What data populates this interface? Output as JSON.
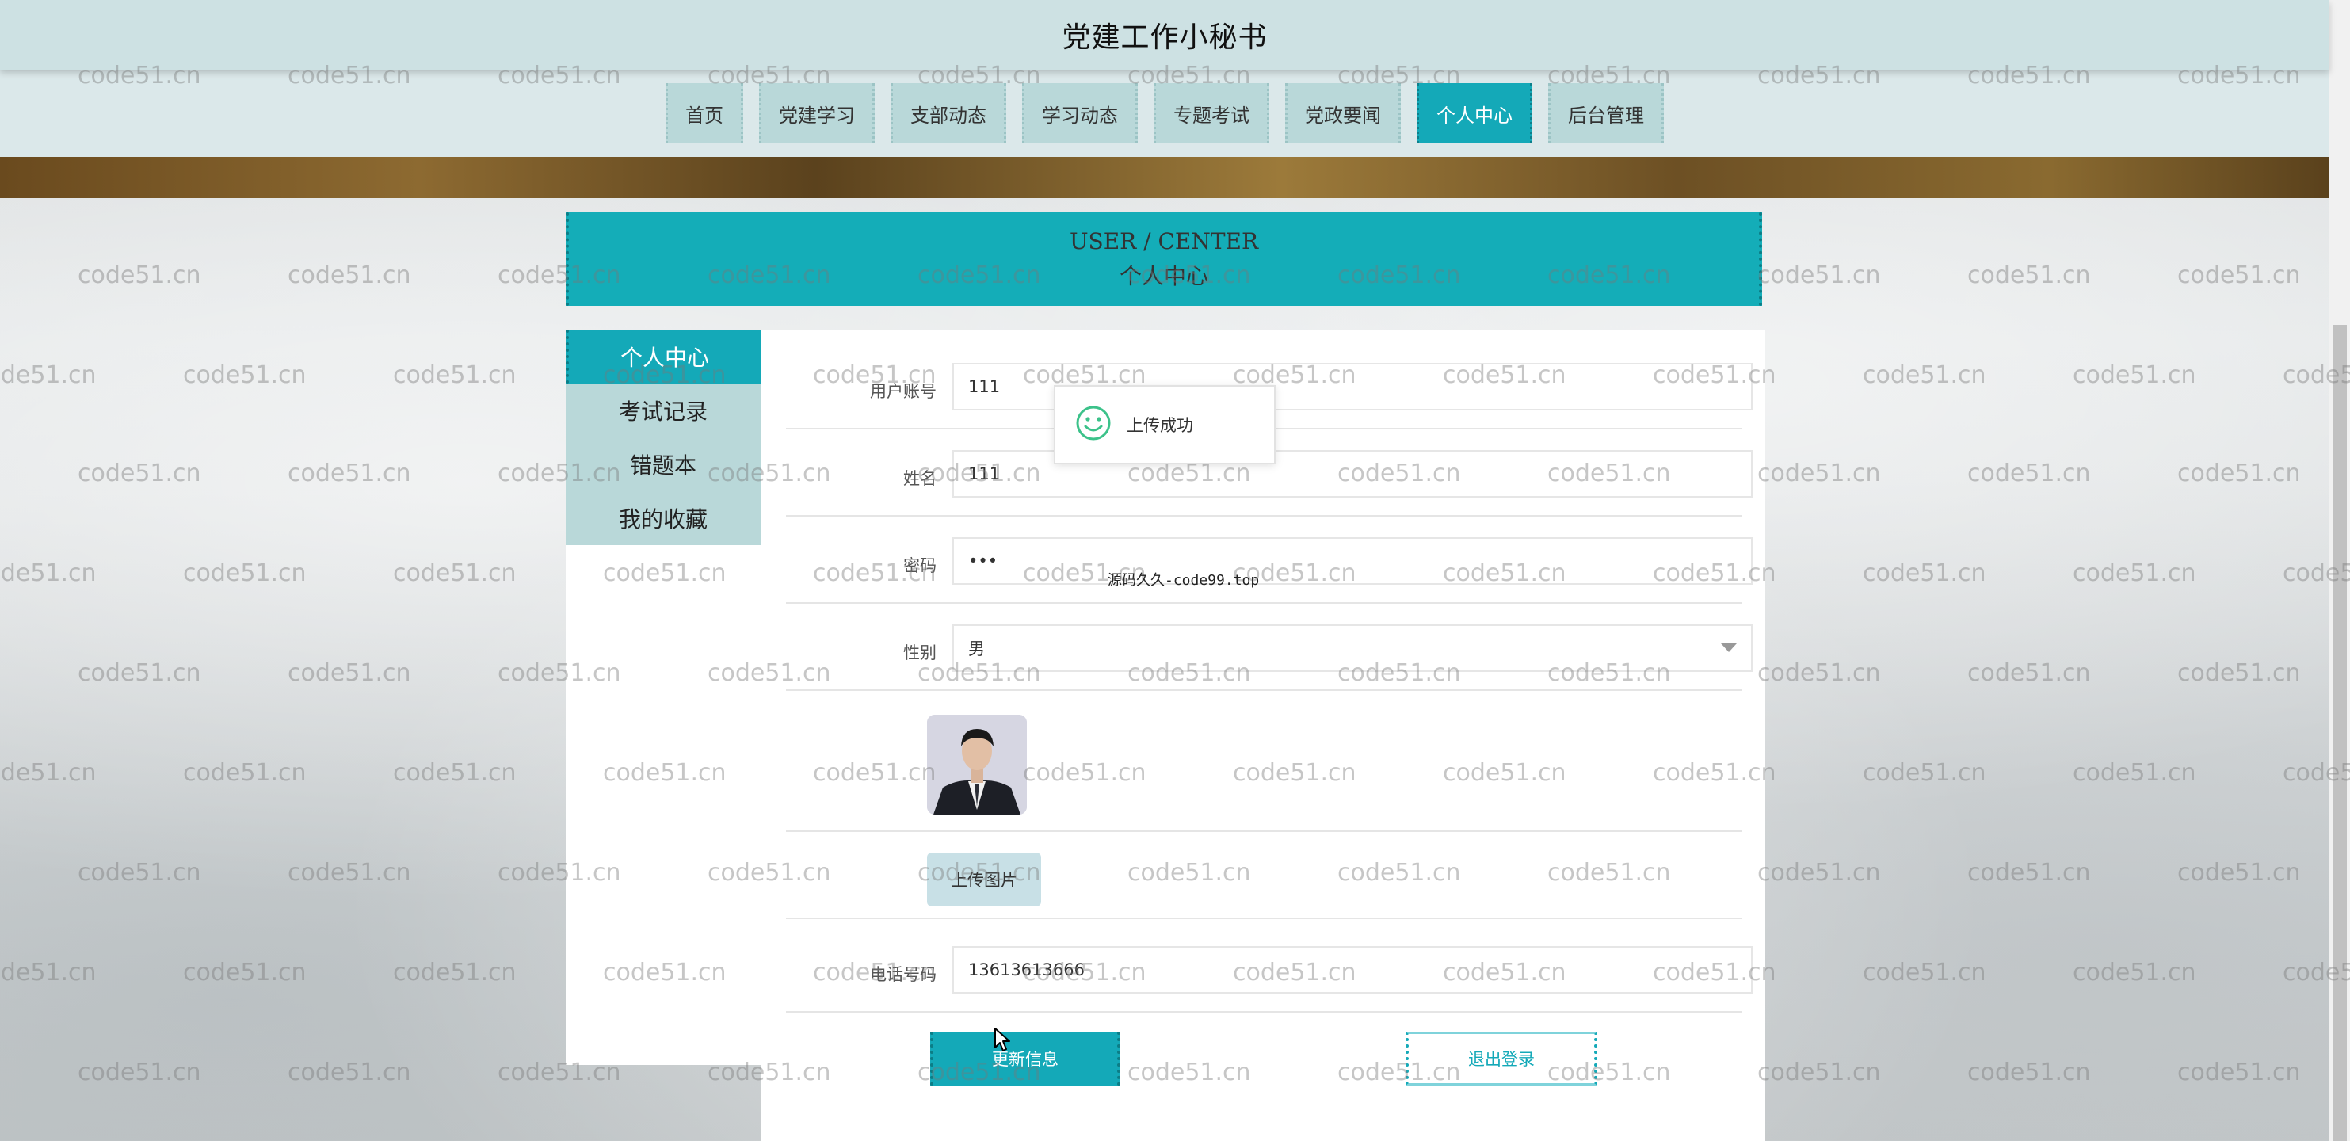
{
  "site": {
    "title": "党建工作小秘书"
  },
  "nav": {
    "items": [
      {
        "label": "首页"
      },
      {
        "label": "党建学习"
      },
      {
        "label": "支部动态"
      },
      {
        "label": "学习动态"
      },
      {
        "label": "专题考试"
      },
      {
        "label": "党政要闻"
      },
      {
        "label": "个人中心",
        "active": true
      },
      {
        "label": "后台管理"
      }
    ]
  },
  "header": {
    "title_en": "USER / CENTER",
    "title_zh": "个人中心"
  },
  "sidebar": {
    "items": [
      {
        "label": "个人中心",
        "active": true
      },
      {
        "label": "考试记录"
      },
      {
        "label": "错题本"
      },
      {
        "label": "我的收藏"
      }
    ]
  },
  "form": {
    "account": {
      "label": "用户账号",
      "value": "111"
    },
    "name": {
      "label": "姓名",
      "value": "111"
    },
    "password": {
      "label": "密码",
      "value": "•••"
    },
    "gender": {
      "label": "性别",
      "value": "男"
    },
    "upload_label": "上传图片",
    "phone": {
      "label": "电话号码",
      "value": "13613613666"
    }
  },
  "actions": {
    "update_label": "更新信息",
    "logout_label": "退出登录"
  },
  "toast": {
    "message": "上传成功",
    "icon": "smile-icon"
  },
  "source_mark": "源码久久-code99.top",
  "watermark_text": "code51.cn",
  "colors": {
    "accent": "#14a9b8",
    "nav_bg": "#b9d8d9",
    "titlebar": "#cde1e3"
  }
}
